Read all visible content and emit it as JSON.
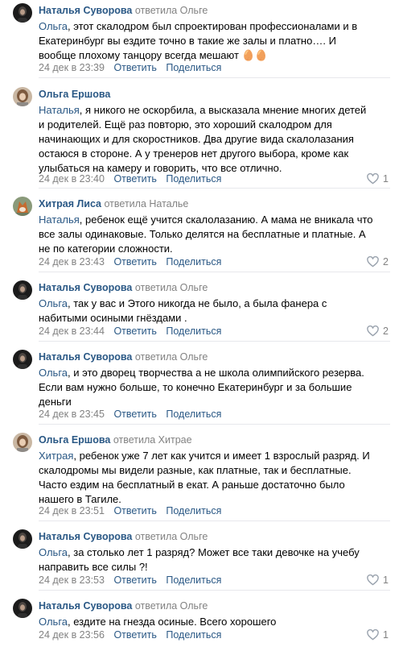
{
  "comments": [
    {
      "author": "Наталья Суворова",
      "replied": "ответила Ольге",
      "mention": "Ольга",
      "text": ", этот скалодром был спроектирован профессионалами и в\nЕкатеринбург вы ездите точно в такие же залы и платно…. И\nвообще плохому танцору всегда мешают 🥚🥚",
      "date": "24 дек в 23:39",
      "reply_label": "Ответить",
      "share_label": "Поделиться",
      "likes": ""
    },
    {
      "author": "Ольга Ершова",
      "replied": "",
      "mention": "Наталья",
      "text": ", я никого не оскорбила, а высказала мнение многих детей\nи родителей. Ещё раз повторю, это хороший скалодром для\nначинающих и для скоростников. Два другие вида скалолазания\nостаюся в стороне. А у тренеров нет другого выбора, кроме как\nулыбаться на камеру и говорить, что все отлично.",
      "date": "24 дек в 23:40",
      "reply_label": "Ответить",
      "share_label": "Поделиться",
      "likes": "1"
    },
    {
      "author": "Хитрая Лиса",
      "replied": "ответила Наталье",
      "mention": "Наталья",
      "text": ", ребенок ещё учится скалолазанию. А мама не вникала что\nвсе залы одинаковые. Только делятся на бесплатные и платные. А\nне по категории сложности.",
      "date": "24 дек в 23:43",
      "reply_label": "Ответить",
      "share_label": "Поделиться",
      "likes": "2"
    },
    {
      "author": "Наталья Суворова",
      "replied": "ответила Ольге",
      "mention": "Ольга",
      "text": ", так у вас и Этого никогда не было, а была фанера с\nнабитыми осиными гнёздами .",
      "date": "24 дек в 23:44",
      "reply_label": "Ответить",
      "share_label": "Поделиться",
      "likes": "2"
    },
    {
      "author": "Наталья Суворова",
      "replied": "ответила Ольге",
      "mention": "Ольга",
      "text": ", и это дворец творчества а не школа олимпийского резерва.\nЕсли вам нужно больше, то конечно Екатеринбург и за большие\nденьги",
      "date": "24 дек в 23:45",
      "reply_label": "Ответить",
      "share_label": "Поделиться",
      "likes": ""
    },
    {
      "author": "Ольга Ершова",
      "replied": "ответила Хитрае",
      "mention": "Хитрая",
      "text": ", ребенок уже 7 лет как учится и имеет 1 взрослый разряд. И\nскалодромы мы видели разные, как платные, так и бесплатные.\nЧасто ездим на бесплатный в екат. А раньше достаточно было\nнашего в Тагиле.",
      "date": "24 дек в 23:51",
      "reply_label": "Ответить",
      "share_label": "Поделиться",
      "likes": ""
    },
    {
      "author": "Наталья Суворова",
      "replied": "ответила Ольге",
      "mention": "Ольга",
      "text": ", за столько лет 1 разряд? Может все таки девочке на учебу\nнаправить все силы ?!",
      "date": "24 дек в 23:53",
      "reply_label": "Ответить",
      "share_label": "Поделиться",
      "likes": "1"
    },
    {
      "author": "Наталья Суворова",
      "replied": "ответила Ольге",
      "mention": "Ольга",
      "text": ", ездите на гнезда осиные. Всего хорошего",
      "date": "24 дек в 23:56",
      "reply_label": "Ответить",
      "share_label": "Поделиться",
      "likes": "1"
    }
  ],
  "colors": {
    "link": "#2a5885",
    "muted": "#828282",
    "divider": "#e7e8ec"
  },
  "icons": {
    "like": "heart-outline-icon"
  }
}
